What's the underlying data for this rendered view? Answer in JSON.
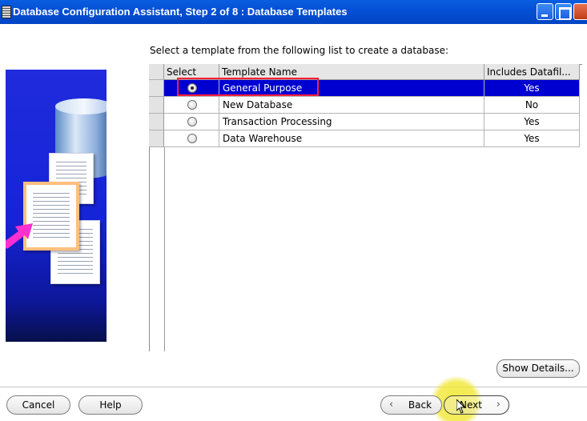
{
  "window": {
    "title": "Database Configuration Assistant, Step 2 of 8 : Database Templates"
  },
  "instruction": "Select a template from the following list to create a database:",
  "table": {
    "columns": [
      "Select",
      "Template Name",
      "Includes Datafil..."
    ],
    "rows": [
      {
        "name": "General Purpose",
        "includes": "Yes",
        "selected": true
      },
      {
        "name": "New Database",
        "includes": "No",
        "selected": false
      },
      {
        "name": "Transaction Processing",
        "includes": "Yes",
        "selected": false
      },
      {
        "name": "Data Warehouse",
        "includes": "Yes",
        "selected": false
      }
    ]
  },
  "buttons": {
    "show_details": "Show Details...",
    "cancel": "Cancel",
    "help": "Help",
    "back": "Back",
    "next": "Next"
  },
  "colors": {
    "title_bar": "#0450d6",
    "selection": "#0000d0",
    "highlight_box": "#ff1f3a",
    "cursor_halo": "#f0e628"
  },
  "icons": [
    "app-icon",
    "minimize-icon",
    "maximize-icon",
    "close-icon",
    "database-icon",
    "document-icon",
    "arrow-icon",
    "chevron-left-icon",
    "chevron-right-icon",
    "mouse-pointer-icon"
  ]
}
